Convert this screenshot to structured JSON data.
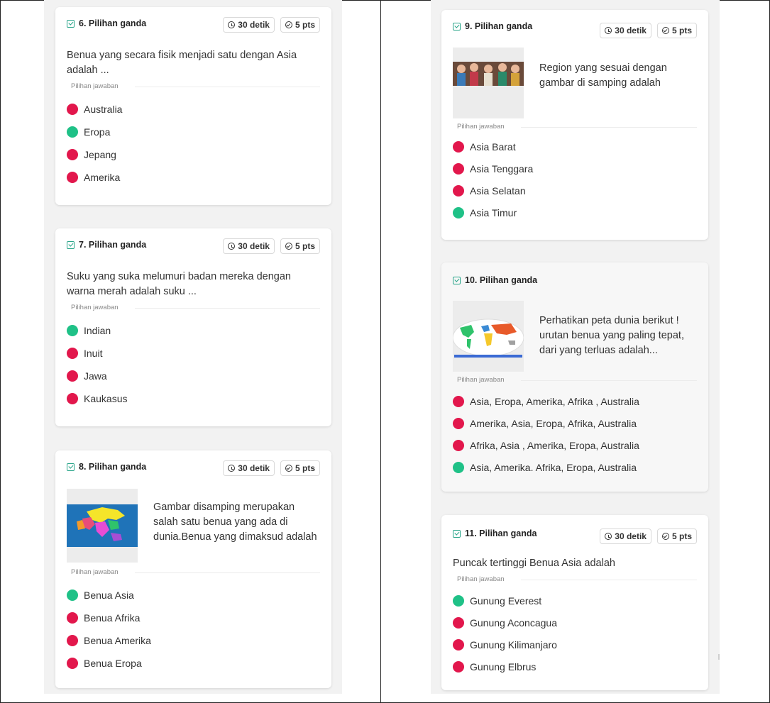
{
  "common": {
    "timer": "30 detik",
    "points": "5 pts",
    "options_heading": "Pilihan jawaban"
  },
  "colors": {
    "correct": "#1fc187",
    "wrong": "#e2174c",
    "check": "#2aa58a"
  },
  "questions": [
    {
      "title": "6. Pilihan ganda",
      "text": "Benua yang secara fisik menjadi satu dengan Asia adalah ...",
      "options": [
        {
          "label": "Australia",
          "correct": false
        },
        {
          "label": "Eropa",
          "correct": true
        },
        {
          "label": "Jepang",
          "correct": false
        },
        {
          "label": "Amerika",
          "correct": false
        }
      ]
    },
    {
      "title": "7. Pilihan ganda",
      "text": "Suku yang suka melumuri badan mereka dengan warna merah adalah suku ...",
      "options": [
        {
          "label": "Indian",
          "correct": true
        },
        {
          "label": "Inuit",
          "correct": false
        },
        {
          "label": "Jawa",
          "correct": false
        },
        {
          "label": "Kaukasus",
          "correct": false
        }
      ]
    },
    {
      "title": "8. Pilihan ganda",
      "text": "Gambar disamping merupakan salah satu benua yang ada di dunia.Benua yang dimaksud adalah",
      "options": [
        {
          "label": "Benua Asia",
          "correct": true
        },
        {
          "label": "Benua Afrika",
          "correct": false
        },
        {
          "label": "Benua Amerika",
          "correct": false
        },
        {
          "label": "Benua Eropa",
          "correct": false
        }
      ]
    },
    {
      "title": "9. Pilihan ganda",
      "text": "Region yang sesuai dengan gambar di samping adalah",
      "options": [
        {
          "label": "Asia Barat",
          "correct": false
        },
        {
          "label": "Asia Tenggara",
          "correct": false
        },
        {
          "label": "Asia Selatan",
          "correct": false
        },
        {
          "label": "Asia Timur",
          "correct": true
        }
      ]
    },
    {
      "title": "10. Pilihan ganda",
      "text": "Perhatikan peta dunia berikut ! urutan benua yang paling tepat, dari yang terluas adalah...",
      "options": [
        {
          "label": "Asia, Eropa, Amerika, Afrika , Australia",
          "correct": false
        },
        {
          "label": "Amerika, Asia, Eropa, Afrika, Australia",
          "correct": false
        },
        {
          "label": "Afrika, Asia , Amerika, Eropa, Australia",
          "correct": false
        },
        {
          "label": "Asia, Amerika. Afrika, Eropa, Australia",
          "correct": true
        }
      ]
    },
    {
      "title": "11. Pilihan ganda",
      "text": "Puncak tertinggi Benua Asia adalah",
      "options": [
        {
          "label": "Gunung Everest",
          "correct": true
        },
        {
          "label": "Gunung Aconcagua",
          "correct": false
        },
        {
          "label": "Gunung Kilimanjaro",
          "correct": false
        },
        {
          "label": "Gunung Elbrus",
          "correct": false
        }
      ]
    }
  ]
}
